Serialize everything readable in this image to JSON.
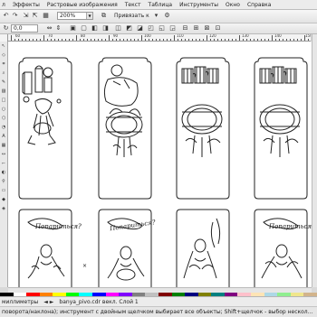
{
  "menu": {
    "items": [
      "л",
      "Эффекты",
      "Растровые изображения",
      "Текст",
      "Таблица",
      "Инструменты",
      "Окно",
      "Справка"
    ]
  },
  "toolbar": {
    "zoom_value": "200%",
    "snap_label": "Привязать к"
  },
  "property_bar": {
    "rotation_value": "0,0"
  },
  "rulers": {
    "top_numbers": [
      "60",
      "70",
      "80",
      "90",
      "100",
      "110",
      "120",
      "130",
      "140",
      "150"
    ]
  },
  "canvas": {
    "panel_text": "Попариться?"
  },
  "status": {
    "units": "миллиметры",
    "layer_info": "banya_pivo.cdr векл. Слой 1",
    "hint": "поворота/наклона); инструмент с двойным щелчком выбирает все объекты; Shift+щелчок - выбор нескол..."
  },
  "palette_colors": [
    "#000000",
    "#ffffff",
    "#ff0000",
    "#ff8000",
    "#ffff00",
    "#00ff00",
    "#00ffff",
    "#0000ff",
    "#ff00ff",
    "#8000ff",
    "#808080",
    "#c0c0c0",
    "#800000",
    "#008000",
    "#000080",
    "#808000",
    "#008080",
    "#800080",
    "#ffc0cb",
    "#ffe4b5",
    "#add8e6",
    "#90ee90",
    "#f0e68c",
    "#d2b48c"
  ]
}
